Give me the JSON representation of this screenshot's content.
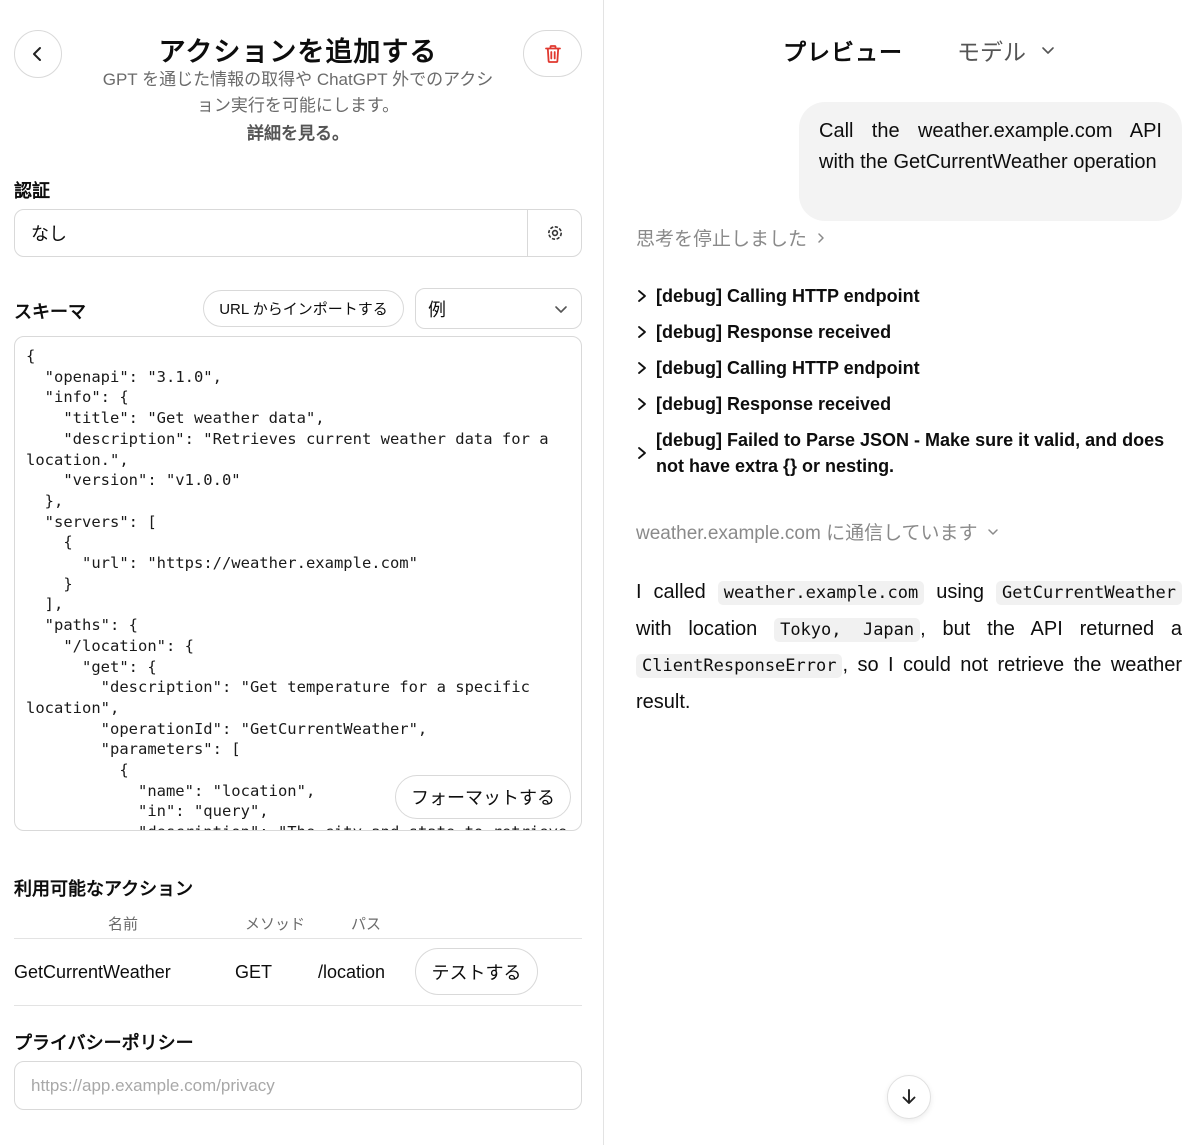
{
  "editor": {
    "title": "アクションを追加する",
    "subtitle": "GPT を通じた情報の取得や ChatGPT 外でのアクション実行を可能にします。",
    "learn_more": "詳細を見る。",
    "auth": {
      "label": "認証",
      "value": "なし"
    },
    "schema": {
      "label": "スキーマ",
      "import_button": "URL からインポートする",
      "example_select": "例",
      "format_button": "フォーマットする",
      "code": "{\n  \"openapi\": \"3.1.0\",\n  \"info\": {\n    \"title\": \"Get weather data\",\n    \"description\": \"Retrieves current weather data for a location.\",\n    \"version\": \"v1.0.0\"\n  },\n  \"servers\": [\n    {\n      \"url\": \"https://weather.example.com\"\n    }\n  ],\n  \"paths\": {\n    \"/location\": {\n      \"get\": {\n        \"description\": \"Get temperature for a specific location\",\n        \"operationId\": \"GetCurrentWeather\",\n        \"parameters\": [\n          {\n            \"name\": \"location\",\n            \"in\": \"query\",\n            \"description\": \"The city and state to retrieve"
    },
    "actions": {
      "label": "利用可能なアクション",
      "columns": {
        "name": "名前",
        "method": "メソッド",
        "path": "パス"
      },
      "row": {
        "name": "GetCurrentWeather",
        "method": "GET",
        "path": "/location",
        "test_button": "テストする"
      }
    },
    "privacy": {
      "label": "プライバシーポリシー",
      "placeholder": "https://app.example.com/privacy"
    }
  },
  "preview": {
    "title": "プレビュー",
    "model_label": "モデル",
    "user_message": "Call the weather.example.com API with the GetCurrentWeather operation",
    "thinking_label": "思考を停止しました",
    "debug": [
      "[debug] Calling HTTP endpoint",
      "[debug] Response received",
      "[debug] Calling HTTP endpoint",
      "[debug] Response received",
      "[debug] Failed to Parse JSON - Make sure it valid, and does not have extra {} or nesting."
    ],
    "status": "weather.example.com に通信しています",
    "answer": {
      "t1": "I called ",
      "c1": "weather.example.com",
      "t2": " using ",
      "c2": "GetCurrentWeather",
      "t3": " with location ",
      "c3": "Tokyo, Japan",
      "t4": ", but the API returned a ",
      "c4": "ClientResponseError",
      "t5": ", so I could not retrieve the weather result."
    }
  },
  "colors": {
    "delete_red": "#e0382f",
    "muted": "#8a8a8a",
    "border": "#d9d9d9"
  },
  "icons": [
    "chevron-left-icon",
    "trash-icon",
    "gear-icon",
    "chevron-down-icon",
    "chevron-right-icon",
    "arrow-down-icon"
  ]
}
